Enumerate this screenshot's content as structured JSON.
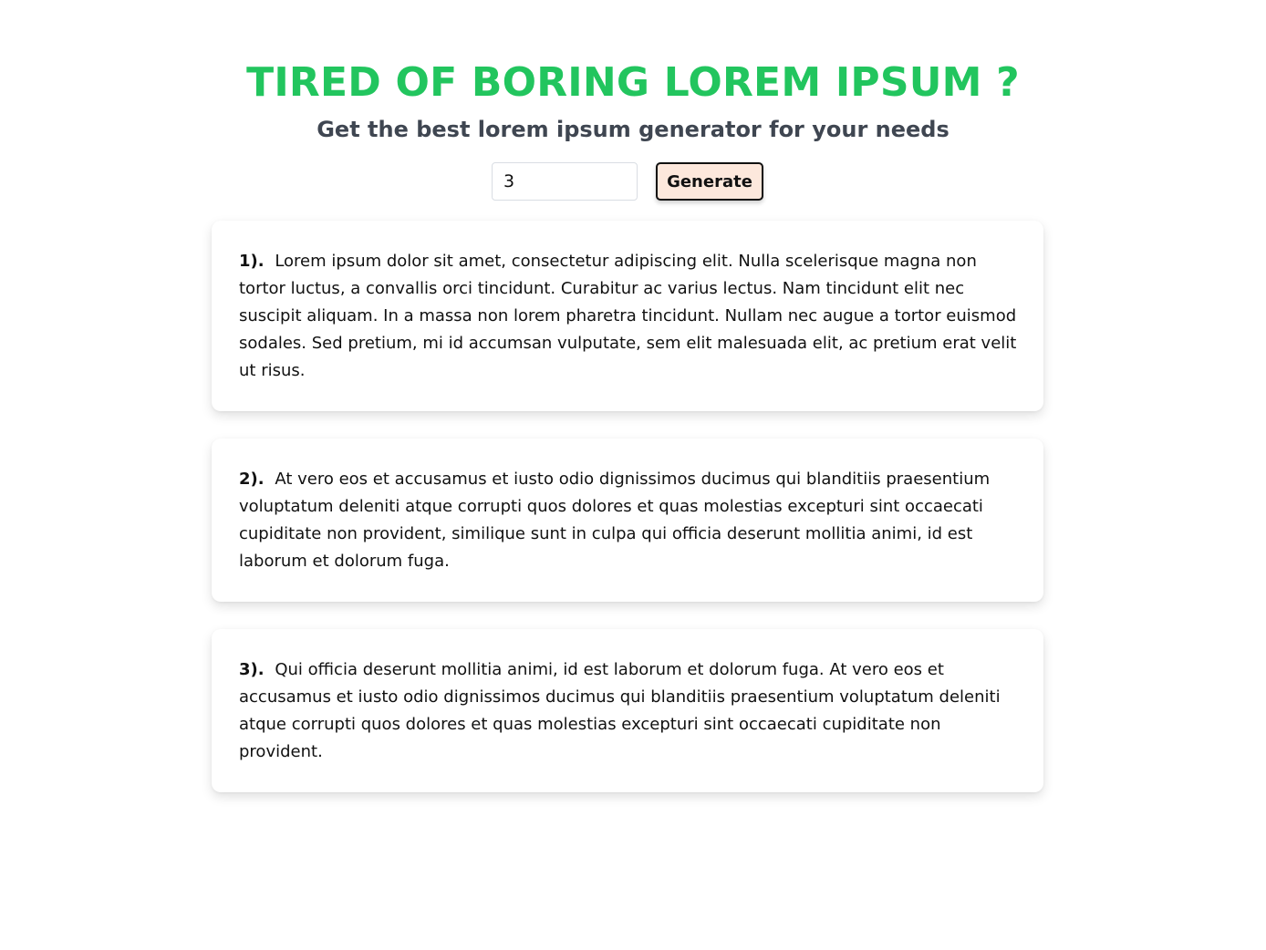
{
  "header": {
    "title": "TIRED OF BORING LOREM IPSUM ?",
    "subtitle": "Get the best lorem ipsum generator for your needs"
  },
  "form": {
    "count_value": "3",
    "generate_label": "Generate"
  },
  "paragraphs": [
    {
      "number": "1).",
      "text": "Lorem ipsum dolor sit amet, consectetur adipiscing elit. Nulla scelerisque magna non tortor luctus, a convallis orci tincidunt. Curabitur ac varius lectus. Nam tincidunt elit nec suscipit aliquam. In a massa non lorem pharetra tincidunt. Nullam nec augue a tortor euismod sodales. Sed pretium, mi id accumsan vulputate, sem elit malesuada elit, ac pretium erat velit ut risus."
    },
    {
      "number": "2).",
      "text": "At vero eos et accusamus et iusto odio dignissimos ducimus qui blanditiis praesentium voluptatum deleniti atque corrupti quos dolores et quas molestias excepturi sint occaecati cupiditate non provident, similique sunt in culpa qui officia deserunt mollitia animi, id est laborum et dolorum fuga."
    },
    {
      "number": "3).",
      "text": "Qui officia deserunt mollitia animi, id est laborum et dolorum fuga. At vero eos et accusamus et iusto odio dignissimos ducimus qui blanditiis praesentium voluptatum deleniti atque corrupti quos dolores et quas molestias excepturi sint occaecati cupiditate non provident."
    }
  ],
  "colors": {
    "title": "#22c55e",
    "subtitle": "#3f4651",
    "button_background": "#fde8dc",
    "button_border": "#111111",
    "text": "#111111"
  }
}
